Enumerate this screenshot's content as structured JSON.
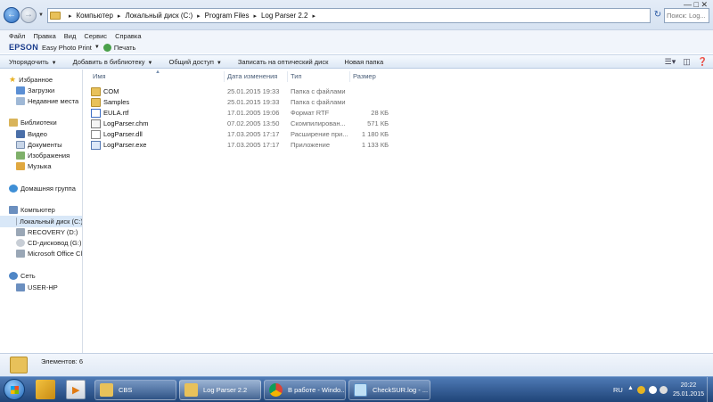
{
  "address": {
    "crumbs": [
      "Компьютер",
      "Локальный диск (C:)",
      "Program Files",
      "Log Parser 2.2"
    ],
    "search_placeholder": "Поиск: Log..."
  },
  "menu": [
    "Файл",
    "Правка",
    "Вид",
    "Сервис",
    "Справка"
  ],
  "epson": {
    "brand": "EPSON",
    "app": "Easy Photo Print",
    "print": "Печать"
  },
  "toolbar": {
    "organize": "Упорядочить",
    "add_library": "Добавить в библиотеку",
    "share": "Общий доступ",
    "burn": "Записать на оптический диск",
    "new_folder": "Новая папка"
  },
  "nav": {
    "favorites": "Избранное",
    "downloads": "Загрузки",
    "recent": "Недавние места",
    "libraries": "Библиотеки",
    "video": "Видео",
    "documents": "Документы",
    "images": "Изображения",
    "music": "Музыка",
    "homegroup": "Домашняя группа",
    "computer": "Компьютер",
    "local_disk": "Локальный диск (C:)",
    "recovery": "RECOVERY (D:)",
    "cd_drive": "CD-дисковод (G:)",
    "office": "Microsoft Office Click-to-Run",
    "network": "Сеть",
    "user_pc": "USER-HP"
  },
  "columns": {
    "name": "Имя",
    "date": "Дата изменения",
    "type": "Тип",
    "size": "Размер"
  },
  "files": [
    {
      "name": "COM",
      "date": "25.01.2015 19:33",
      "type": "Папка с файлами",
      "size": "",
      "icon": "folder-icon"
    },
    {
      "name": "Samples",
      "date": "25.01.2015 19:33",
      "type": "Папка с файлами",
      "size": "",
      "icon": "folder-icon"
    },
    {
      "name": "EULA.rtf",
      "date": "17.01.2005 19:06",
      "type": "Формат RTF",
      "size": "28 КБ",
      "icon": "rtf-file-icon"
    },
    {
      "name": "LogParser.chm",
      "date": "07.02.2005 13:50",
      "type": "Скомпилирован...",
      "size": "571 КБ",
      "icon": "chm-file-icon"
    },
    {
      "name": "LogParser.dll",
      "date": "17.03.2005 17:17",
      "type": "Расширение при...",
      "size": "1 180 КБ",
      "icon": "dll-file-icon"
    },
    {
      "name": "LogParser.exe",
      "date": "17.03.2005 17:17",
      "type": "Приложение",
      "size": "1 133 КБ",
      "icon": "exe-file-icon"
    }
  ],
  "status": {
    "count": "Элементов: 6"
  },
  "taskbar": {
    "buttons": [
      "CBS",
      "Log Parser 2.2",
      "В работе - Windo...",
      "CheckSUR.log - ..."
    ],
    "lang": "RU",
    "time": "20:22",
    "date": "25.01.2015"
  },
  "colors": {
    "accent": "#2b6cbf",
    "folder": "#e8c15a",
    "taskbar": "#1f4478"
  }
}
